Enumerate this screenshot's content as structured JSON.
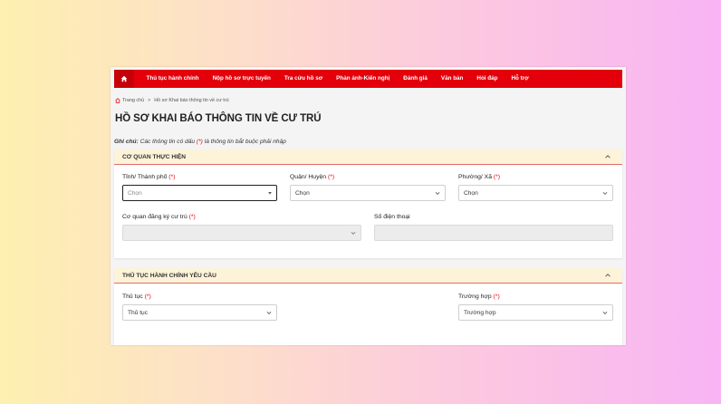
{
  "nav": {
    "home_icon": "home-icon",
    "items": [
      {
        "label": "Thủ tục hành chính"
      },
      {
        "label": "Nộp hồ sơ trực tuyến"
      },
      {
        "label": "Tra cứu hồ sơ"
      },
      {
        "label": "Phản ánh-Kiến nghị"
      },
      {
        "label": "Đánh giá"
      },
      {
        "label": "Văn bản"
      },
      {
        "label": "Hỏi đáp"
      },
      {
        "label": "Hỗ trợ"
      }
    ],
    "color": "#e3000b"
  },
  "breadcrumb": {
    "home": "Trang chủ",
    "separator": ">",
    "current": "Hồ sơ Khai báo thông tin về cư trú"
  },
  "page_title": "HỒ SƠ KHAI BÁO THÔNG TIN VỀ CƯ TRÚ",
  "note": {
    "label": "Ghi chú:",
    "text_before": "Các thông tin có dấu",
    "marker": "(*)",
    "text_after": "là thông tin bắt buộc phải nhập"
  },
  "section1": {
    "title": "CƠ QUAN THỰC HIỆN",
    "province": {
      "label": "Tỉnh/ Thành phố",
      "required": "(*)",
      "value": "Chọn"
    },
    "district": {
      "label": "Quận/ Huyện",
      "required": "(*)",
      "value": "Chọn"
    },
    "ward": {
      "label": "Phường/ Xã",
      "required": "(*)",
      "value": "Chọn"
    },
    "agency": {
      "label": "Cơ quan đăng ký cư trú",
      "required": "(*)",
      "value": ""
    },
    "phone": {
      "label": "Số điện thoại",
      "value": ""
    }
  },
  "section2": {
    "title": "THỦ TỤC HÀNH CHÍNH YÊU CẦU",
    "procedure": {
      "label": "Thủ tục",
      "required": "(*)",
      "value": "Thủ tục"
    },
    "case": {
      "label": "Trường hợp",
      "required": "(*)",
      "value": "Trường hợp"
    }
  }
}
